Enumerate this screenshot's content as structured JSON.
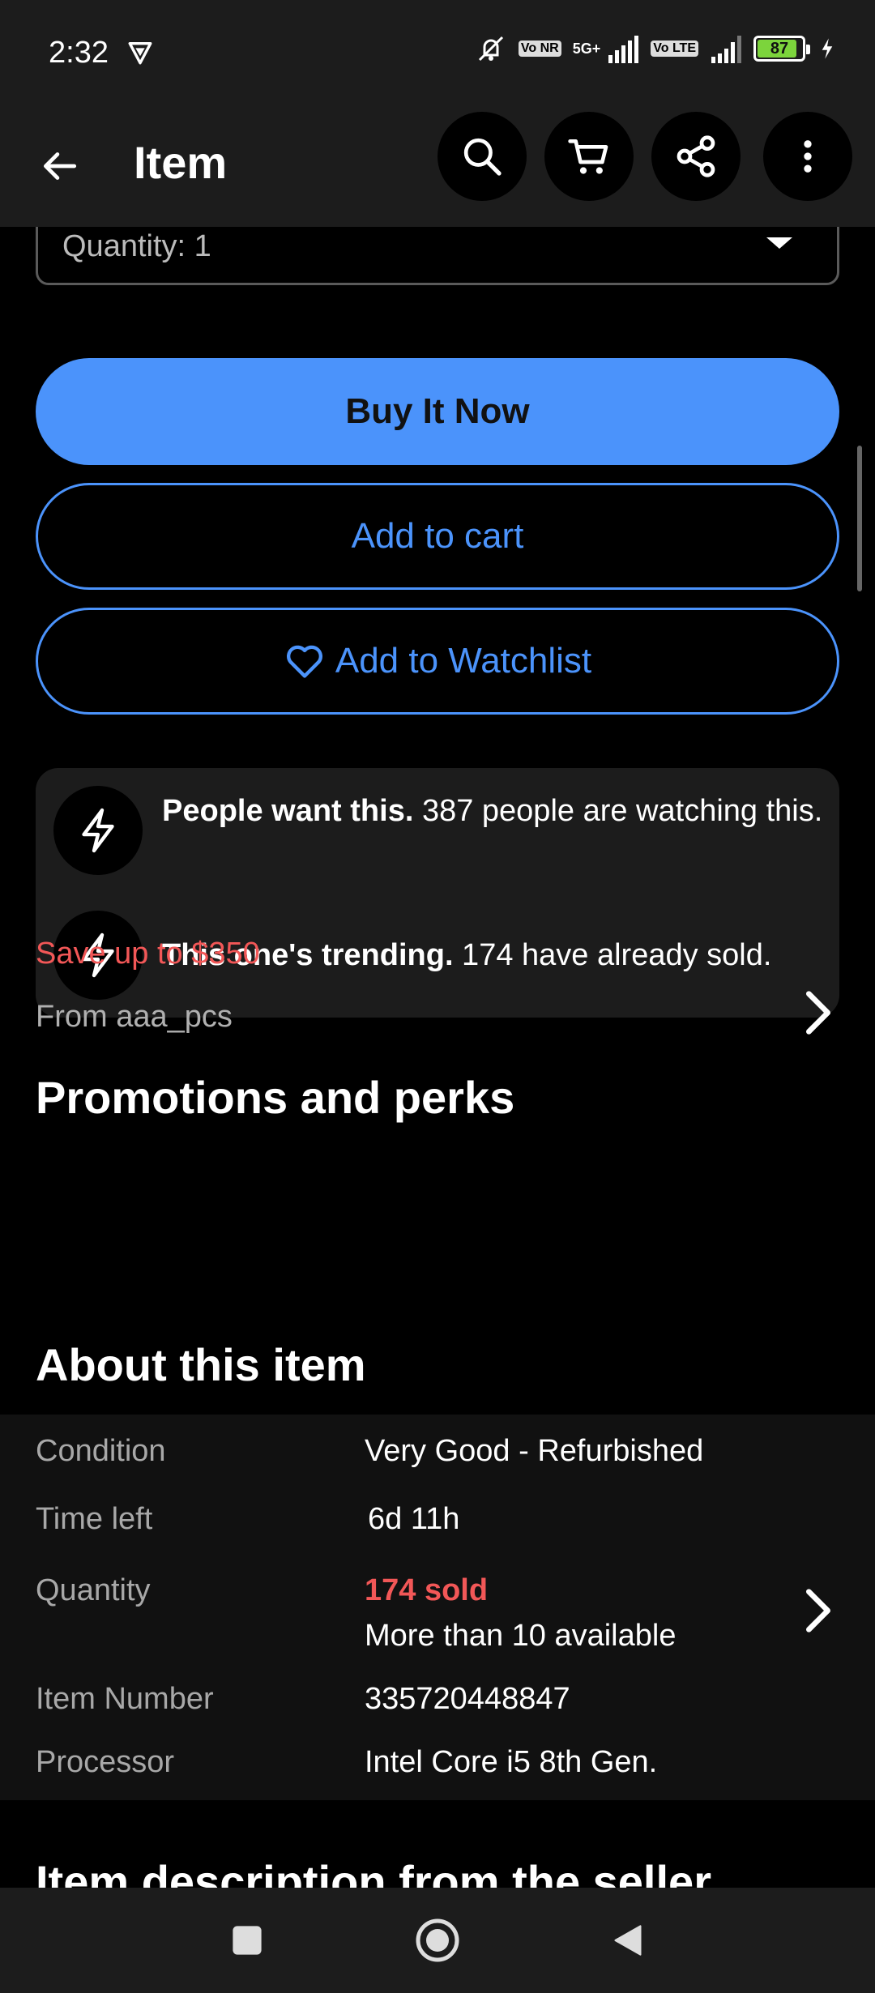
{
  "status_bar": {
    "time": "2:32",
    "battery": "87",
    "network": "5G+",
    "volte1": "Vo NR",
    "volte2": "Vo LTE"
  },
  "app_bar": {
    "title": "Item"
  },
  "quantity_select": {
    "value": "Quantity: 1"
  },
  "buttons": {
    "buy_now": "Buy It Now",
    "add_to_cart": "Add to cart",
    "add_to_watchlist": "Add to Watchlist"
  },
  "signals": [
    {
      "strong": "People want this.",
      "text": " 387 people are watching this."
    },
    {
      "strong": "This one's trending.",
      "text": " 174 have already sold."
    }
  ],
  "promotions": {
    "title": "Promotions and perks",
    "save": "Save up to $350",
    "from": "From aaa_pcs"
  },
  "about": {
    "title": "About this item",
    "rows": [
      {
        "label": "Condition",
        "value": "Very Good - Refurbished"
      },
      {
        "label": "Time left",
        "value": "6d 11h"
      },
      {
        "label": "Quantity",
        "value": "174 sold",
        "value2": "More than 10 available"
      },
      {
        "label": "Item Number",
        "value": "335720448847"
      },
      {
        "label": "Processor",
        "value": "Intel Core i5 8th Gen."
      }
    ]
  },
  "description": {
    "title": "Item description from the seller"
  },
  "colors": {
    "accent": "#4b93fb",
    "alert": "#f25757",
    "background": "#000000",
    "surface": "#1c1c1c"
  }
}
